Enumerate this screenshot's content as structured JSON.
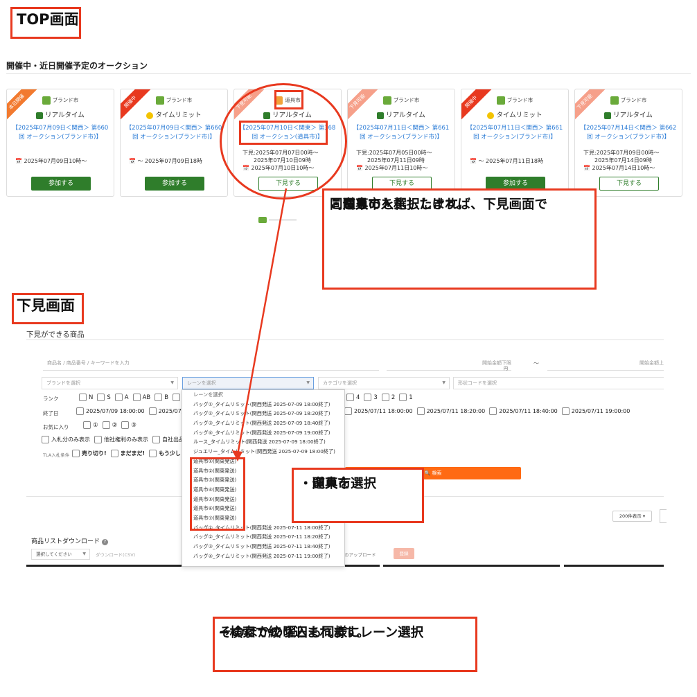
{
  "top_label": "TOP画面",
  "section_title": "開催中・近日開催予定のオークション",
  "cards": [
    {
      "ribbon": "本日開催",
      "ribbon_color": "#f27a2f",
      "category": "ブランド市",
      "type": "リアルタイム",
      "title": "【2025年07月09日＜関西＞ 第660回 オークション(ブランド市)】",
      "dates": [
        "📅 2025年07月09日10時〜"
      ],
      "button": "参加する",
      "button_style": "primary"
    },
    {
      "ribbon": "開催中",
      "ribbon_color": "#e8391f",
      "category": "ブランド市",
      "type": "タイムリミット",
      "title": "【2025年07月09日＜関西＞ 第660回 オークション(ブランド市)】",
      "dates": [
        "📅 〜 2025年07月09日18時"
      ],
      "button": "参加する",
      "button_style": "primary"
    },
    {
      "ribbon": "下見可能",
      "ribbon_color": "#f6a08a",
      "category": "道具市",
      "type": "リアルタイム",
      "title": "【2025年07月10日＜関東＞ 第368回 オークション(道具市)】",
      "dates": [
        "下見:2025年07月07日00時〜",
        "2025年07月10日09時",
        "📅 2025年07月10日10時〜"
      ],
      "button": "下見する",
      "button_style": "outline"
    },
    {
      "ribbon": "下見可能",
      "ribbon_color": "#f6a08a",
      "category": "ブランド市",
      "type": "リアルタイム",
      "title": "【2025年07月11日＜関西＞ 第661回 オークション(ブランド市)】",
      "dates": [
        "下見:2025年07月05日00時〜",
        "2025年07月11日09時",
        "📅 2025年07月11日10時〜"
      ],
      "button": "下見する",
      "button_style": "outline"
    },
    {
      "ribbon": "開催中",
      "ribbon_color": "#e8391f",
      "category": "ブランド市",
      "type": "タイムリミット",
      "title": "【2025年07月11日＜関西＞ 第661回 オークション(ブランド市)】",
      "dates": [
        "📅 〜 2025年07月11日18時"
      ],
      "button": "参加する",
      "button_style": "primary"
    },
    {
      "ribbon": "下見可能",
      "ribbon_color": "#f6a08a",
      "category": "ブランド市",
      "type": "リアルタイム",
      "title": "【2025年07月14日＜関西＞ 第662回 オークション(ブランド市)】",
      "dates": [
        "下見:2025年07月09日00時〜",
        "2025年07月14日09時",
        "📅 2025年07月14日10時〜"
      ],
      "button": "下見する",
      "button_style": "outline"
    }
  ],
  "note1": [
    "こちらで入札したければ、下見画面で",
    "同じものを選択します。",
    "・道具市",
    "・関東"
  ],
  "preview_label": "下見画面",
  "preview_title": "下見ができる商品",
  "form": {
    "keyword_placeholder": "商品名 / 商品番号 / キーワードを入力",
    "price_min_placeholder": "開始金額下限",
    "yen": "円",
    "tilde": "〜",
    "price_max_placeholder": "開始金額上",
    "brand_placeholder": "ブランドを選択",
    "lane_placeholder": "レーンを選択",
    "category_placeholder": "カテゴリを選択",
    "model_placeholder": "形状コードを選択",
    "rank_label": "ランク",
    "ranks_left": [
      "N",
      "S",
      "A",
      "AB",
      "B",
      "BC"
    ],
    "ranks_right": [
      "4",
      "3",
      "2",
      "1"
    ],
    "end_label": "終了日",
    "end_dates_left": [
      "2025/07/09 18:00:00",
      "2025/07/"
    ],
    "end_dates_right": [
      "2025/07/11 18:00:00",
      "2025/07/11 18:20:00",
      "2025/07/11 18:40:00",
      "2025/07/11 19:00:00"
    ],
    "fav_label": "お気に入り",
    "favs": [
      "①",
      "②",
      "③"
    ],
    "opts": [
      "入札分のみ表示",
      "他社権利のみ表示",
      "自社出品"
    ],
    "tla_label": "TLA入札条件",
    "tla_opts": [
      "売り切り!",
      "まだまだ!",
      "もう少し!"
    ],
    "search_button": "🔍 検索",
    "per_page": "200件表示 ▾",
    "download_title": "商品リストダウンロード",
    "download_select": "選択してください",
    "download_csv": "ダウンロード(CSV)",
    "upload_label": "のアップロード",
    "upload_btn": "登録"
  },
  "dropdown": [
    "レーンを選択",
    "バッグ①_タイムリミット(関西発送 2025-07-09 18:00終了)",
    "バッグ②_タイムリミット(関西発送 2025-07-09 18:20終了)",
    "バッグ③_タイムリミット(関西発送 2025-07-09 18:40終了)",
    "バッグ④_タイムリミット(関西発送 2025-07-09 19:00終了)",
    "ルース_タイムリミット(関西発送 2025-07-09 18:00終了)",
    "ジュエリー_タイムリミット(関西発送 2025-07-09 18:00終了)",
    "道具市①(関東発送)",
    "道具市②(関東発送)",
    "道具市③(関東発送)",
    "道具市④(関東発送)",
    "道具市⑤(関東発送)",
    "道具市⑥(関東発送)",
    "道具市⑦(関東発送)",
    "バッグ①_タイムリミット(関西発送 2025-07-11 18:00終了)",
    "バッグ②_タイムリミット(関西発送 2025-07-11 18:20終了)",
    "バッグ③_タイムリミット(関西発送 2025-07-11 18:40終了)",
    "バッグ④_タイムリミット(関西発送 2025-07-11 19:00終了)"
  ],
  "note2": [
    "・道具市",
    "・関東を選択"
  ],
  "note3": [
    "そのほかの曜日も同様にレーン選択",
    "→検索で絞り込まれます。"
  ]
}
